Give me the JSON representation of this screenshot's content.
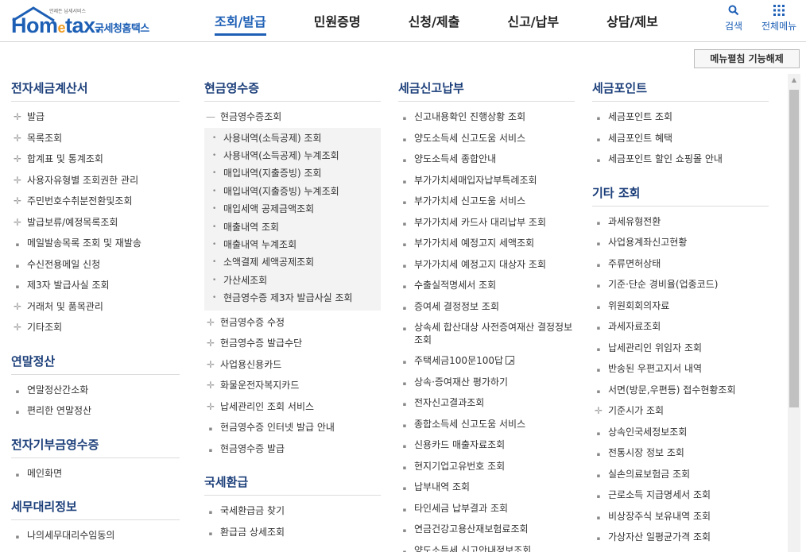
{
  "header": {
    "logo_tag": "언제든 납세서비스",
    "logo_main_1": "Hom",
    "logo_main_e": "e",
    "logo_main_2": "tax.",
    "logo_sub": "국세청홈택스",
    "nav": [
      "조회/발급",
      "민원증명",
      "신청/제출",
      "신고/납부",
      "상담/제보"
    ],
    "search_label": "검색",
    "allmenu_label": "전체메뉴"
  },
  "fold_button": "메뉴펼침 기능해제",
  "col1": {
    "sections": [
      {
        "title": "전자세금계산서",
        "items": [
          {
            "t": "발급",
            "m": "plus"
          },
          {
            "t": "목록조회",
            "m": "plus"
          },
          {
            "t": "합계표 및 통계조회",
            "m": "plus"
          },
          {
            "t": "사용자유형별 조회권한 관리",
            "m": "plus"
          },
          {
            "t": "주민번호수취분전환및조회",
            "m": "plus"
          },
          {
            "t": "발급보류/예정목록조회",
            "m": "plus"
          },
          {
            "t": "메일발송목록 조회 및 재발송",
            "m": "dot"
          },
          {
            "t": "수신전용메일 신청",
            "m": "dot"
          },
          {
            "t": "제3자 발급사실 조회",
            "m": "dot"
          },
          {
            "t": "거래처 및 품목관리",
            "m": "plus"
          },
          {
            "t": "기타조회",
            "m": "plus"
          }
        ]
      },
      {
        "title": "연말정산",
        "items": [
          {
            "t": "연말정산간소화",
            "m": "dot"
          },
          {
            "t": "편리한 연말정산",
            "m": "dot"
          }
        ]
      },
      {
        "title": "전자기부금영수증",
        "items": [
          {
            "t": "메인화면",
            "m": "dot"
          }
        ]
      },
      {
        "title": "세무대리정보",
        "items": [
          {
            "t": "나의세무대리수임동의",
            "m": "dot"
          }
        ]
      }
    ]
  },
  "col2": {
    "title": "현금영수증",
    "open_item": "현금영수증조회",
    "sub_items": [
      "사용내역(소득공제) 조회",
      "사용내역(소득공제) 누계조회",
      "매입내역(지출증빙) 조회",
      "매입내역(지출증빙) 누계조회",
      "매입세액 공제금액조회",
      "매출내역 조회",
      "매출내역 누계조회",
      "소액결제 세액공제조회",
      "가산세조회",
      "현금영수증 제3자 발급사실 조회"
    ],
    "items": [
      {
        "t": "현금영수증 수정",
        "m": "plus"
      },
      {
        "t": "현금영수증 발급수단",
        "m": "plus"
      },
      {
        "t": "사업용신용카드",
        "m": "plus"
      },
      {
        "t": "화물운전자복지카드",
        "m": "plus"
      },
      {
        "t": "납세관리인 조회 서비스",
        "m": "plus"
      },
      {
        "t": "현금영수증 인터넷 발급 안내",
        "m": "dot"
      },
      {
        "t": "현금영수증 발급",
        "m": "dot"
      }
    ],
    "title2": "국세환급",
    "items2": [
      {
        "t": "국세환급금 찾기",
        "m": "dot"
      },
      {
        "t": "환급금 상세조회",
        "m": "dot"
      }
    ]
  },
  "col3": {
    "title": "세금신고납부",
    "items": [
      {
        "t": "신고내용확인 진행상황 조회",
        "m": "dot"
      },
      {
        "t": "양도소득세 신고도움 서비스",
        "m": "dot"
      },
      {
        "t": "양도소득세 종합안내",
        "m": "dot"
      },
      {
        "t": "부가가치세매입자납부특례조회",
        "m": "dot"
      },
      {
        "t": "부가가치세 신고도움 서비스",
        "m": "dot"
      },
      {
        "t": "부가가치세 카드사 대리납부 조회",
        "m": "dot"
      },
      {
        "t": "부가가치세 예정고지 세액조회",
        "m": "dot"
      },
      {
        "t": "부가가치세 예정고지 대상자 조회",
        "m": "dot"
      },
      {
        "t": "수출실적명세서 조회",
        "m": "dot"
      },
      {
        "t": "증여세 결정정보 조회",
        "m": "dot"
      },
      {
        "t": "상속세 합산대상 사전증여재산 결정정보 조회",
        "m": "dot",
        "wrap": true
      },
      {
        "t": "주택세금100문100답",
        "m": "dot",
        "ext": true
      },
      {
        "t": "상속·증여재산 평가하기",
        "m": "dot"
      },
      {
        "t": "전자신고결과조회",
        "m": "dot"
      },
      {
        "t": "종합소득세 신고도움 서비스",
        "m": "dot"
      },
      {
        "t": "신용카드 매출자료조회",
        "m": "dot"
      },
      {
        "t": "현지기업고유번호 조회",
        "m": "dot"
      },
      {
        "t": "납부내역 조회",
        "m": "dot"
      },
      {
        "t": "타인세금 납부결과 조회",
        "m": "dot"
      },
      {
        "t": "연금건강고용산재보험료조회",
        "m": "dot"
      },
      {
        "t": "양도소득세 신고안내정보조회",
        "m": "dot"
      }
    ]
  },
  "col4": {
    "title": "세금포인트",
    "items": [
      {
        "t": "세금포인트 조회",
        "m": "dot"
      },
      {
        "t": "세금포인트 혜택",
        "m": "dot"
      },
      {
        "t": "세금포인트 할인 쇼핑몰 안내",
        "m": "dot"
      }
    ],
    "title2": "기타 조회",
    "items2": [
      {
        "t": "과세유형전환",
        "m": "dot"
      },
      {
        "t": "사업용계좌신고현황",
        "m": "dot"
      },
      {
        "t": "주류면허상태",
        "m": "dot"
      },
      {
        "t": "기준·단순 경비율(업종코드)",
        "m": "dot"
      },
      {
        "t": "위원회회의자료",
        "m": "dot"
      },
      {
        "t": "과세자료조회",
        "m": "dot"
      },
      {
        "t": "납세관리인 위임자 조회",
        "m": "dot"
      },
      {
        "t": "반송된 우편고지서 내역",
        "m": "dot"
      },
      {
        "t": "서면(방문,우편등) 접수현황조회",
        "m": "dot"
      },
      {
        "t": "기준시가 조회",
        "m": "plus"
      },
      {
        "t": "상속인국세정보조회",
        "m": "dot"
      },
      {
        "t": "전통시장 정보 조회",
        "m": "dot"
      },
      {
        "t": "실손의료보험금 조회",
        "m": "dot"
      },
      {
        "t": "근로소득 지급명세서 조회",
        "m": "dot"
      },
      {
        "t": "비상장주식 보유내역 조회",
        "m": "dot"
      },
      {
        "t": "가상자산 일평균가격 조회",
        "m": "dot"
      }
    ]
  },
  "icons": {
    "plus": "plus-icon",
    "minus": "minus-icon",
    "dot": "bullet-icon",
    "search": "search-icon",
    "allmenu": "grid-menu-icon",
    "external": "external-link-icon"
  },
  "colors": {
    "brand_blue": "#1d5fb5",
    "section_title": "#1c3f7a",
    "accent_orange": "#f19b1f"
  }
}
